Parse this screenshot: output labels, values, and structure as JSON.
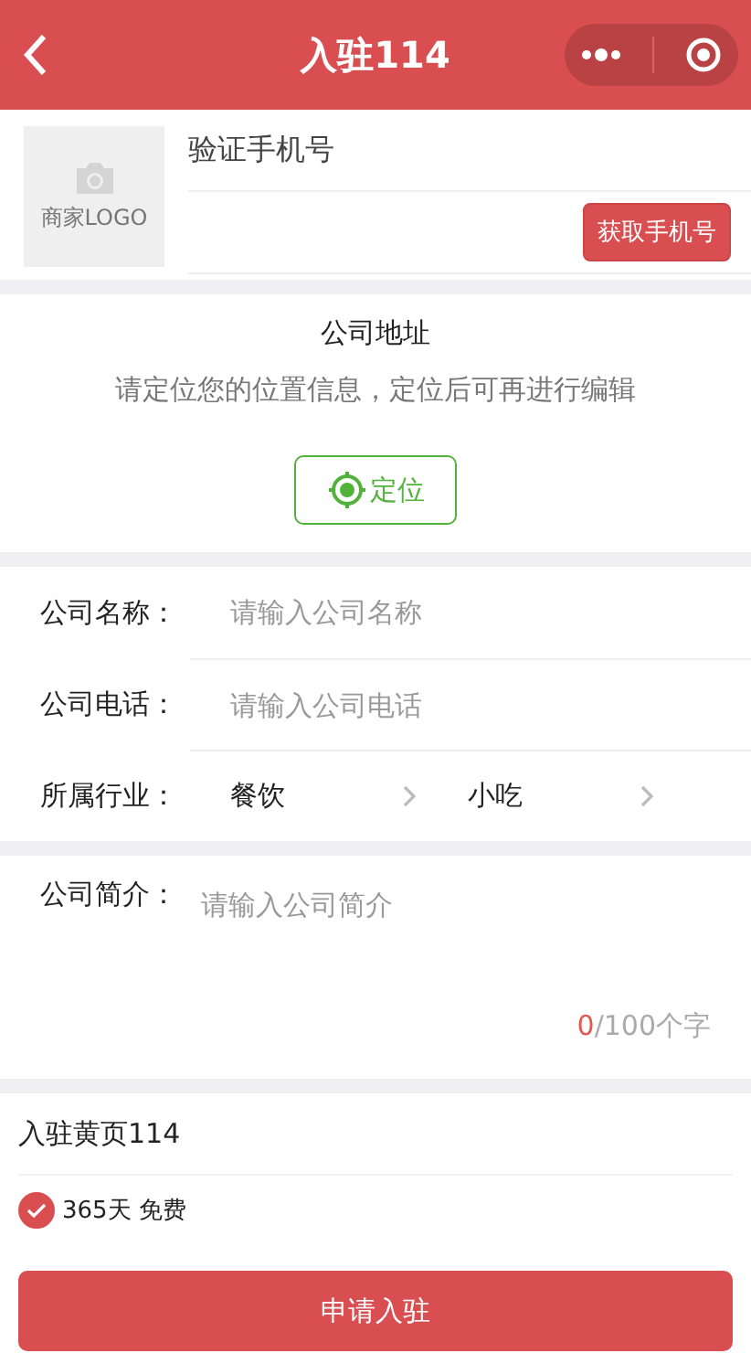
{
  "header": {
    "title": "入驻114"
  },
  "logo": {
    "label": "商家LOGO"
  },
  "phone": {
    "label": "验证手机号",
    "button": "获取手机号"
  },
  "address": {
    "title": "公司地址",
    "hint": "请定位您的位置信息，定位后可再进行编辑",
    "button": "定位"
  },
  "fields": [
    {
      "kind": "input",
      "label": "公司名称：",
      "placeholder": "请输入公司名称"
    },
    {
      "kind": "input",
      "label": "公司电话：",
      "placeholder": "请输入公司电话"
    },
    {
      "kind": "select",
      "label": "所属行业：",
      "values": [
        "餐饮",
        "小吃"
      ]
    }
  ],
  "intro": {
    "label": "公司简介：",
    "placeholder": "请输入公司简介",
    "count": "0",
    "limit": "/100个字"
  },
  "plan": {
    "title": "入驻黄页114",
    "option": "365天 免费",
    "checked": true
  },
  "submit": "申请入驻"
}
